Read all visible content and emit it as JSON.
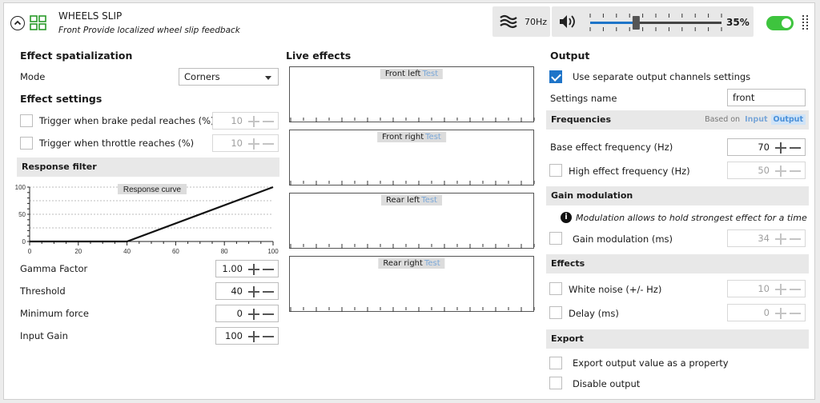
{
  "header": {
    "title": "WHEELS SLIP",
    "subtitle": "Front Provide localized wheel slip feedback",
    "frequency": "70Hz",
    "volume": "35%",
    "volume_level": 0.35,
    "enabled": true
  },
  "left": {
    "spatialization_title": "Effect spatialization",
    "mode_label": "Mode",
    "mode_value": "Corners",
    "settings_title": "Effect settings",
    "brake_label": "Trigger when brake pedal reaches (%)",
    "brake_value": "10",
    "throttle_label": "Trigger when throttle reaches (%)",
    "throttle_value": "10",
    "response_filter_title": "Response filter",
    "curve_title": "Response curve",
    "gamma_label": "Gamma Factor",
    "gamma_value": "1.00",
    "threshold_label": "Threshold",
    "threshold_value": "40",
    "minforce_label": "Minimum force",
    "minforce_value": "0",
    "inputgain_label": "Input Gain",
    "inputgain_value": "100"
  },
  "chart_data": {
    "type": "line",
    "title": "Response curve",
    "x": [
      0,
      40,
      100
    ],
    "y": [
      0,
      0,
      100
    ],
    "xlim": [
      0,
      100
    ],
    "ylim": [
      0,
      100
    ],
    "xticks": [
      "0",
      "20",
      "40",
      "60",
      "80",
      "100"
    ],
    "yticks": [
      "0",
      "50",
      "100"
    ],
    "grid": true
  },
  "live": {
    "title": "Live effects",
    "charts": [
      {
        "label": "Front left",
        "test": "Test"
      },
      {
        "label": "Front right",
        "test": "Test"
      },
      {
        "label": "Rear left",
        "test": "Test"
      },
      {
        "label": "Rear right",
        "test": "Test"
      }
    ]
  },
  "output": {
    "title": "Output",
    "separate_label": "Use separate output channels settings",
    "separate_checked": true,
    "settings_name_label": "Settings name",
    "settings_name_value": "front",
    "frequencies_title": "Frequencies",
    "based_on": "Based on",
    "based_input": "Input",
    "based_output": "Output",
    "base_freq_label": "Base effect frequency (Hz)",
    "base_freq_value": "70",
    "high_freq_label": "High effect frequency (Hz)",
    "high_freq_value": "50",
    "gain_mod_title": "Gain modulation",
    "gain_mod_info": "Modulation allows to hold strongest effect for a time",
    "gain_mod_label": "Gain modulation (ms)",
    "gain_mod_value": "34",
    "effects_title": "Effects",
    "white_noise_label": "White noise (+/- Hz)",
    "white_noise_value": "10",
    "delay_label": "Delay (ms)",
    "delay_value": "0",
    "export_title": "Export",
    "export_prop_label": "Export output value as a property",
    "disable_label": "Disable output"
  }
}
